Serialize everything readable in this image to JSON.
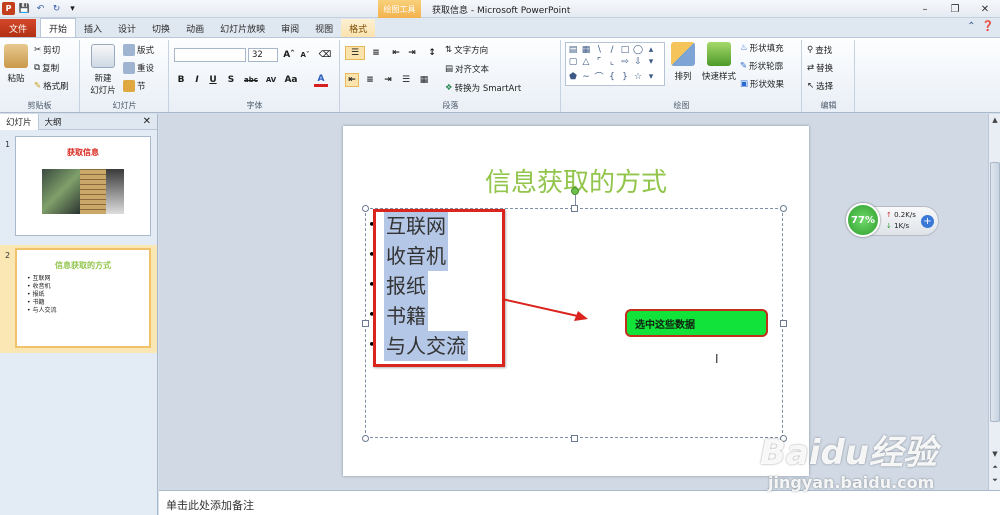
{
  "titlebar": {
    "app_logo": "P",
    "context_tab": "绘图工具",
    "title": "获取信息 - Microsoft PowerPoint",
    "qat_icons": [
      "save-icon",
      "undo-icon",
      "redo-icon",
      "customize-icon"
    ]
  },
  "tabs": [
    "文件",
    "开始",
    "插入",
    "设计",
    "切换",
    "动画",
    "幻灯片放映",
    "审阅",
    "视图",
    "格式"
  ],
  "ribbon": {
    "clipboard": {
      "paste": "粘贴",
      "cut": "剪切",
      "copy": "复制",
      "format_painter": "格式刷",
      "label": "剪贴板"
    },
    "slides": {
      "new_slide": "新建\n幻灯片",
      "layout": "版式",
      "reset": "重设",
      "section": "节",
      "label": "幻灯片"
    },
    "font": {
      "font_name": "",
      "font_size": "32",
      "bold": "B",
      "italic": "I",
      "underline": "U",
      "shadow": "S",
      "strike": "abc",
      "spacing": "AV",
      "case": "Aa",
      "color": "A",
      "label": "字体"
    },
    "paragraph": {
      "text_direction": "文字方向",
      "align_text": "对齐文本",
      "smartart": "转换为 SmartArt",
      "label": "段落"
    },
    "drawing": {
      "arrange": "排列",
      "quick_styles": "快速样式",
      "shape_fill": "形状填充",
      "shape_outline": "形状轮廓",
      "shape_effects": "形状效果",
      "label": "绘图"
    },
    "editing": {
      "find": "查找",
      "replace": "替换",
      "select": "选择",
      "label": "编辑"
    }
  },
  "left_pane": {
    "tab_slides": "幻灯片",
    "tab_outline": "大纲",
    "slide1": {
      "num": "1",
      "title": "获取信息"
    },
    "slide2": {
      "num": "2",
      "title": "信息获取的方式",
      "items": [
        "互联网",
        "收音机",
        "报纸",
        "书籍",
        "与人交流"
      ]
    }
  },
  "slide": {
    "title": "信息获取的方式",
    "bullets": [
      "互联网",
      "收音机",
      "报纸",
      "书籍",
      "与人交流"
    ],
    "callout": "选中这些数据"
  },
  "net_widget": {
    "percent": "77%",
    "upload": "0.2K/s",
    "download": "1K/s"
  },
  "notes": {
    "placeholder": "单击此处添加备注"
  },
  "watermark": {
    "brand": "Baidu经验",
    "site": "jingyan.baidu.com"
  },
  "colors": {
    "title_green": "#92c54c",
    "callout_fill": "#12e33a",
    "highlight_red": "#d9251d",
    "selection_blue": "#b4c7e7"
  }
}
